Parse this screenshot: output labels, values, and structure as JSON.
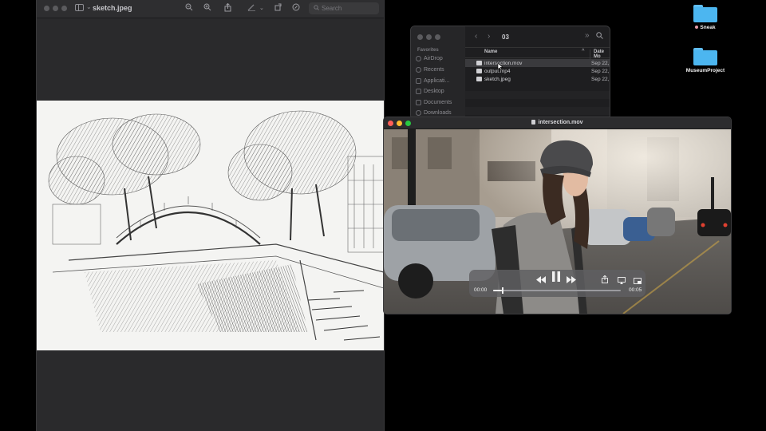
{
  "preview": {
    "title": "sketch.jpeg",
    "search_placeholder": "Search"
  },
  "finder": {
    "folder": "03",
    "sidebar_heading": "Favorites",
    "sidebar": [
      "AirDrop",
      "Recents",
      "Applicati...",
      "Desktop",
      "Documents",
      "Downloads"
    ],
    "columns": {
      "name": "Name",
      "date": "Date Mo"
    },
    "files": [
      {
        "name": "intersection.mov",
        "date": "Sep 22,",
        "selected": true
      },
      {
        "name": "output.mp4",
        "date": "Sep 22,",
        "selected": false
      },
      {
        "name": "sketch.jpeg",
        "date": "Sep 22,",
        "selected": false
      }
    ]
  },
  "quicktime": {
    "title": "intersection.mov",
    "time_current": "00:00",
    "time_total": "00:05",
    "progress": 0.07
  },
  "desktop": {
    "icons": [
      {
        "label": "Sneak",
        "tag_color": "#e49aa6"
      },
      {
        "label": "MuseumProject"
      }
    ]
  },
  "colors": {
    "folder_blue": "#4cb6f0",
    "close_red": "#ff5f57",
    "minimize_yellow": "#febc2e",
    "zoom_green": "#28c840"
  }
}
